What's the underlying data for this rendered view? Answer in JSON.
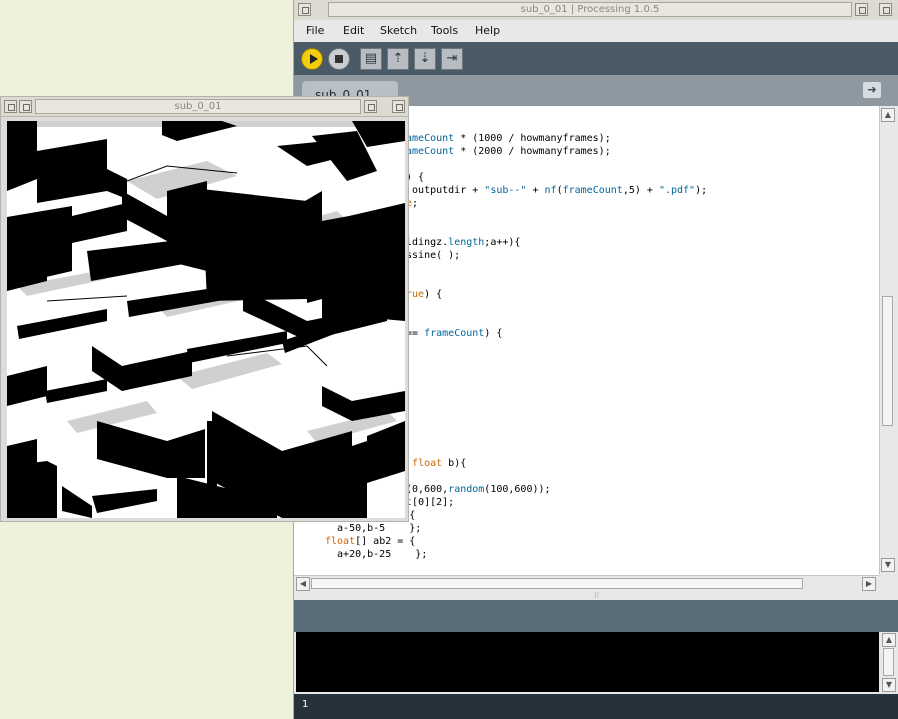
{
  "ide": {
    "title": "sub_0_01 | Processing 1.0.5",
    "menus": [
      "File",
      "Edit",
      "Sketch",
      "Tools",
      "Help"
    ],
    "toolbar": [
      "run",
      "stop",
      "new",
      "open",
      "save",
      "export"
    ],
    "tab_label": "sub_0_01",
    "code_lines": [
      "",
      "",
      "rameCount * (1000 / howmanyframes);",
      "rameCount * (2000 / howmanyframes);",
      "",
      "e) {",
      ", outputdir + \"sub--\" + nf(frameCount,5) + \".pdf\");",
      "ue;",
      "",
      "",
      "ildingz.length;a++){",
      "essine( );",
      "",
      "",
      "true) {",
      "",
      "",
      " == frameCount) {",
      "",
      "",
      "",
      "",
      "",
      "",
      "",
      "",
      "",
      ", float b){",
      "",
      "r(0,600,random(100,600));",
      "at[0][2];",
      "float[] ab1 = {",
      "  a-50,b-5    };",
      "float[] ab2 = {",
      "  a+20,b-25    };"
    ],
    "status_line": "1"
  },
  "sketch": {
    "title": "sub_0_01"
  }
}
